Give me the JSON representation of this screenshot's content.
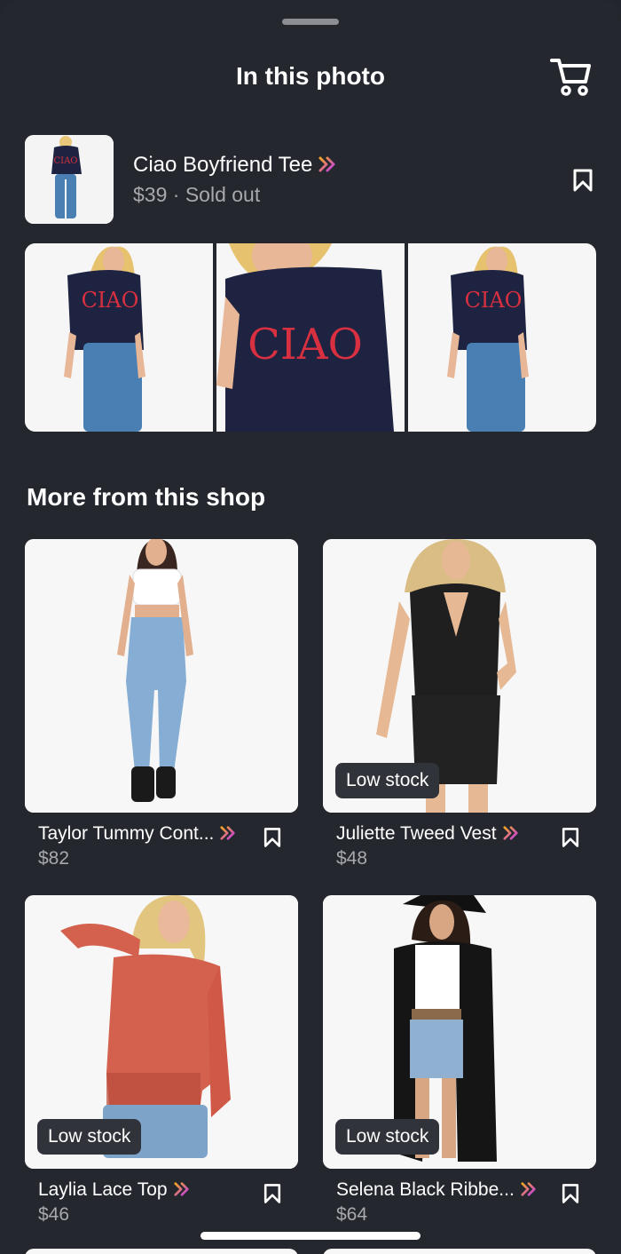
{
  "header": {
    "title": "In this photo",
    "cart_icon": "cart-icon"
  },
  "product": {
    "name": "Ciao Boyfriend Tee",
    "price": "$39",
    "separator": " · ",
    "status": "Sold out",
    "thumb_print": "CIAO",
    "gallery_prints": [
      "CIAO",
      "CIAO",
      "CIAO"
    ]
  },
  "section": {
    "title": "More from this shop"
  },
  "items": [
    {
      "name": "Taylor Tummy Cont...",
      "price": "$82",
      "badge": ""
    },
    {
      "name": "Juliette Tweed Vest",
      "price": "$48",
      "badge": "Low stock"
    },
    {
      "name": "Laylia Lace Top",
      "price": "$46",
      "badge": "Low stock"
    },
    {
      "name": "Selena Black Ribbe...",
      "price": "$64",
      "badge": "Low stock"
    }
  ],
  "colors": {
    "background": "#25272e",
    "accent_gradient_start": "#f5a623",
    "accent_gradient_end": "#c13ae6",
    "muted_text": "#a7a9ae"
  }
}
